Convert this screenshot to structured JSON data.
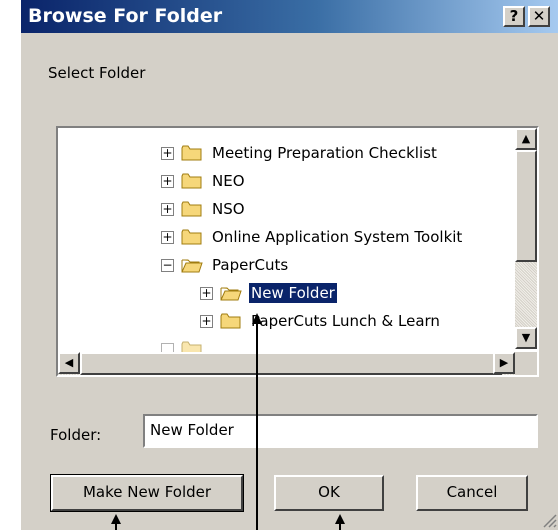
{
  "window": {
    "title": "Browse For Folder",
    "help_label": "?",
    "close_label": "✕"
  },
  "instruction": "Select Folder",
  "tree": {
    "items": [
      {
        "label": "Meeting Preparation Checklist",
        "expander": "+"
      },
      {
        "label": "NEO",
        "expander": "+"
      },
      {
        "label": "NSO",
        "expander": "+"
      },
      {
        "label": "Online Application System Toolkit",
        "expander": "+"
      },
      {
        "label": "PaperCuts",
        "expander": "−"
      },
      {
        "label": "New Folder",
        "expander": "+"
      },
      {
        "label": "PaperCuts Lunch & Learn",
        "expander": "+"
      }
    ],
    "selected_index": 5,
    "editing_index": 5
  },
  "scroll": {
    "up_arrow": "▲",
    "down_arrow": "▼",
    "left_arrow": "◀",
    "right_arrow": "▶"
  },
  "folder": {
    "label": "Folder:",
    "value": "New Folder"
  },
  "buttons": {
    "make_new_folder": "Make New Folder",
    "ok": "OK",
    "cancel": "Cancel"
  },
  "colors": {
    "title_start": "#0a246a",
    "title_end": "#a6caf0",
    "selection": "#0a246a",
    "face": "#d4d0c8",
    "folder_fill": "#f6d77a"
  }
}
